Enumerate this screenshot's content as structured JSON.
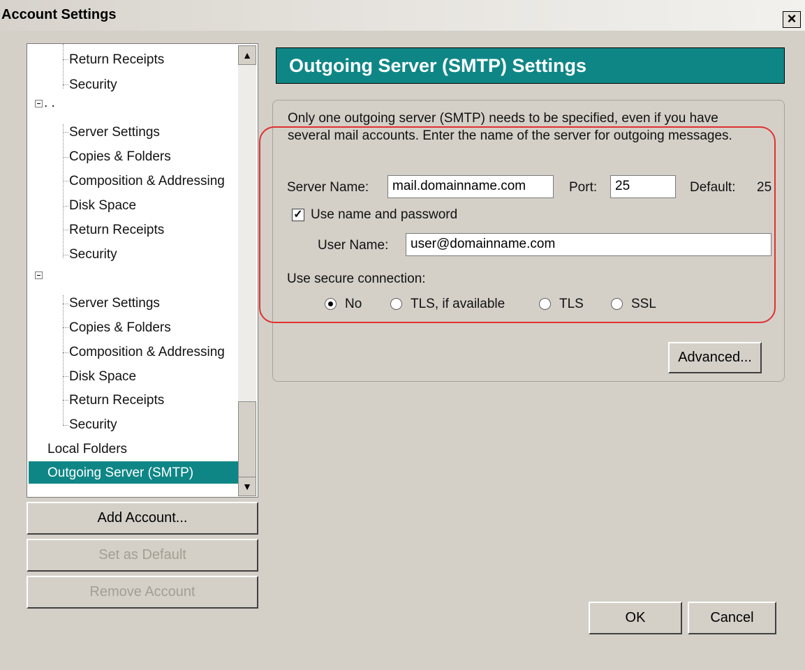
{
  "window": {
    "title": "Account Settings",
    "close_glyph": "×"
  },
  "tree": {
    "items": [
      {
        "label": "Return Receipts"
      },
      {
        "label": "Security"
      },
      {
        "label": ". ."
      },
      {
        "label": "Server Settings"
      },
      {
        "label": "Copies & Folders"
      },
      {
        "label": "Composition & Addressing"
      },
      {
        "label": "Disk Space"
      },
      {
        "label": "Return Receipts"
      },
      {
        "label": "Security"
      },
      {
        "label": "Server Settings"
      },
      {
        "label": "Copies & Folders"
      },
      {
        "label": "Composition & Addressing"
      },
      {
        "label": "Disk Space"
      },
      {
        "label": "Return Receipts"
      },
      {
        "label": "Security"
      },
      {
        "label": "Local Folders"
      },
      {
        "label": "Outgoing Server (SMTP)"
      }
    ],
    "selected": "Outgoing Server (SMTP)"
  },
  "buttons": {
    "add_account": "Add Account...",
    "set_default": "Set as Default",
    "remove_account": "Remove Account",
    "advanced": "Advanced...",
    "ok": "OK",
    "cancel": "Cancel"
  },
  "panel": {
    "title": "Outgoing Server (SMTP) Settings",
    "intro_line1": "Only one outgoing server (SMTP) needs to be specified, even if you have",
    "intro_line2": "several mail accounts. Enter the name of the server for outgoing messages.",
    "server_name_label": "Server Name:",
    "server_name_value": "mail.domainname.com",
    "port_label": "Port:",
    "port_value": "25",
    "default_label": "Default:",
    "default_value": "25",
    "use_name_password_label": "Use name and password",
    "use_name_password_checked": true,
    "user_name_label": "User Name:",
    "user_name_value": "user@domainname.com",
    "secure_label": "Use secure connection:",
    "radio": {
      "no": "No",
      "tls_if_available": "TLS, if available",
      "tls": "TLS",
      "ssl": "SSL",
      "selected": "No"
    }
  },
  "colors": {
    "accent": "#0f8686",
    "dialog_bg": "#d4d0c8",
    "annotation": "#e03030"
  },
  "icons": {
    "close": "close-icon",
    "expander": "minus-box-icon",
    "scroll_up": "scroll-up-icon",
    "scroll_down": "scroll-down-icon",
    "checkbox": "checkbox-checked-icon"
  }
}
